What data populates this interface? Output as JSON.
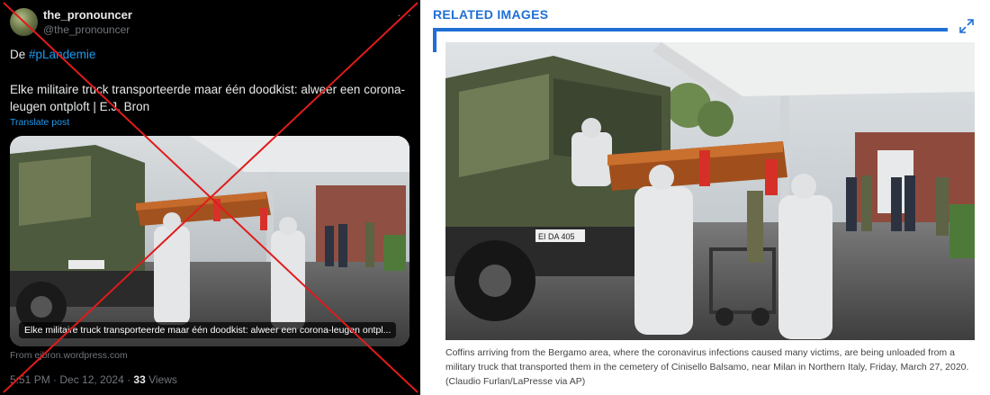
{
  "post": {
    "display_name": "the_pronouncer",
    "handle": "@the_pronouncer",
    "intro": "De",
    "hashtag": "#pLandemie",
    "text": "Elke militaire truck transporteerde maar één doodkist: alweer een corona-leugen ontploft | E.J. Bron",
    "translate_label": "Translate post",
    "card_caption": "Elke militaire truck transporteerde maar één doodkist: alweer een corona-leugen ontpl...",
    "link_source": "From ejbron.wordpress.com",
    "timestamp": "5:51 PM · Dec 12, 2024 · ",
    "views_count": "33",
    "views_label": " Views",
    "cross_color": "#e01b1b"
  },
  "related": {
    "title": "RELATED IMAGES",
    "caption": "Coffins arriving from the Bergamo area, where the coronavirus infections caused many victims, are being unloaded from a military truck that transported them in the cemetery of Cinisello Balsamo, near Milan in Northern Italy, Friday, March 27, 2020. (Claudio Furlan/LaPresse via AP)",
    "accent_color": "#1f6fd6",
    "truck_plate": "EI DA 405"
  }
}
